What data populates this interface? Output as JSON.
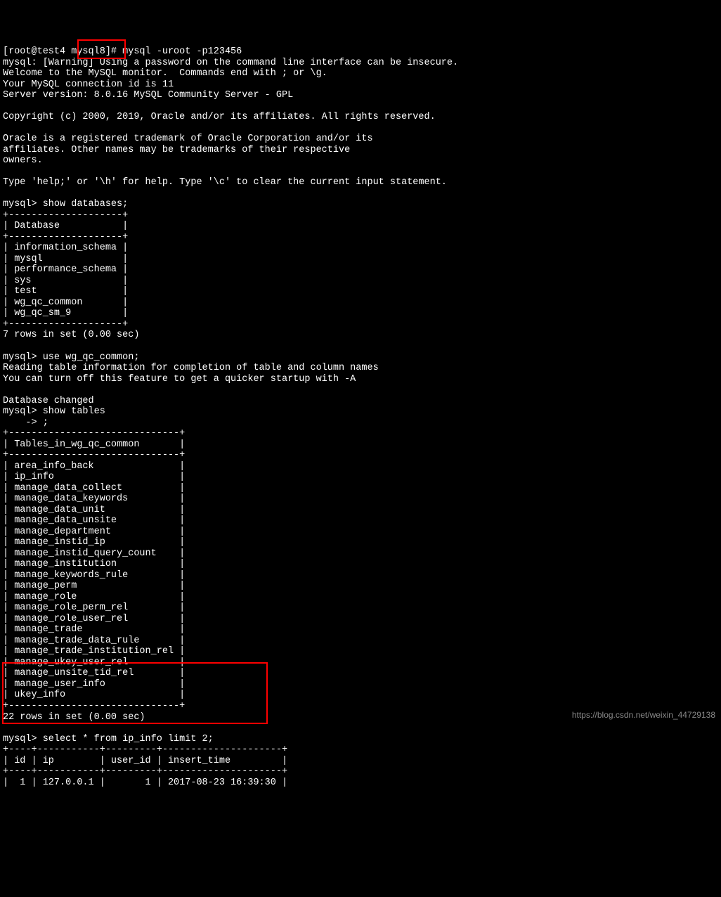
{
  "terminal": {
    "prompt_line": "[root@test4 mysql8]# mysql -uroot -p123456",
    "warning": "mysql: [Warning] Using a password on the command line interface can be insecure.",
    "welcome": "Welcome to the MySQL monitor.  Commands end with ; or \\g.",
    "connection": "Your MySQL connection id is 11",
    "version": "Server version: 8.0.16 MySQL Community Server - GPL",
    "copyright": "Copyright (c) 2000, 2019, Oracle and/or its affiliates. All rights reserved.",
    "trademark1": "Oracle is a registered trademark of Oracle Corporation and/or its",
    "trademark2": "affiliates. Other names may be trademarks of their respective",
    "trademark3": "owners.",
    "help": "Type 'help;' or '\\h' for help. Type '\\c' to clear the current input statement.",
    "cmd1": "mysql> show databases;",
    "db_border": "+--------------------+",
    "db_header": "| Database           |",
    "databases": [
      "| information_schema |",
      "| mysql              |",
      "| performance_schema |",
      "| sys                |",
      "| test               |",
      "| wg_qc_common       |",
      "| wg_qc_sm_9         |"
    ],
    "db_result": "7 rows in set (0.00 sec)",
    "cmd2": "mysql> use wg_qc_common;",
    "reading": "Reading table information for completion of table and column names",
    "turnoff": "You can turn off this feature to get a quicker startup with -A",
    "changed": "Database changed",
    "cmd3": "mysql> show tables",
    "cmd3_cont": "    -> ;",
    "tbl_border": "+------------------------------+",
    "tbl_header": "| Tables_in_wg_qc_common       |",
    "tables": [
      "| area_info_back               |",
      "| ip_info                      |",
      "| manage_data_collect          |",
      "| manage_data_keywords         |",
      "| manage_data_unit             |",
      "| manage_data_unsite           |",
      "| manage_department            |",
      "| manage_instid_ip             |",
      "| manage_instid_query_count    |",
      "| manage_institution           |",
      "| manage_keywords_rule         |",
      "| manage_perm                  |",
      "| manage_role                  |",
      "| manage_role_perm_rel         |",
      "| manage_role_user_rel         |",
      "| manage_trade                 |",
      "| manage_trade_data_rule       |",
      "| manage_trade_institution_rel |",
      "| manage_ukey_user_rel         |",
      "| manage_unsite_tid_rel        |",
      "| manage_user_info             |",
      "| ukey_info                    |"
    ],
    "tbl_result": "22 rows in set (0.00 sec)",
    "cmd4": "mysql> select * from ip_info limit 2;",
    "sel_border": "+----+-----------+---------+---------------------+",
    "sel_header": "| id | ip        | user_id | insert_time         |",
    "sel_row1": "|  1 | 127.0.0.1 |       1 | 2017-08-23 16:39:30 |"
  },
  "watermark": "https://blog.csdn.net/weixin_44729138"
}
